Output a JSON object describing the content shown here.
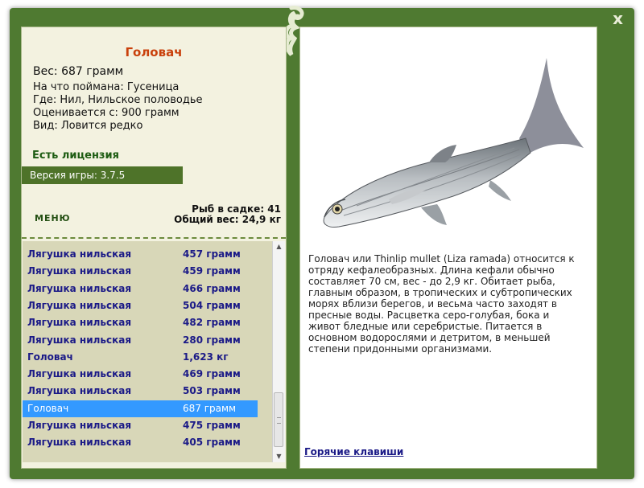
{
  "window": {
    "close_label": "x"
  },
  "fish": {
    "name": "Головач",
    "weight": "Вес: 687 грамм",
    "bait": "На что поймана: Гусеница",
    "location": "Где: Нил, Нильское половодье",
    "valued": "Оценивается с: 900 грамм",
    "kind": "Вид: Ловится редко"
  },
  "license": "Есть лицензия",
  "version": "Версия игры: 3.7.5",
  "menu_label": "МЕНЮ",
  "stats": {
    "count": "Рыб в садке: 41",
    "total": "Общий вес: 24,9 кг"
  },
  "catch_list": [
    {
      "name": "Лягушка нильская",
      "weight": "457 грамм"
    },
    {
      "name": "Лягушка нильская",
      "weight": "459 грамм"
    },
    {
      "name": "Лягушка нильская",
      "weight": "466 грамм"
    },
    {
      "name": "Лягушка нильская",
      "weight": "504 грамм"
    },
    {
      "name": "Лягушка нильская",
      "weight": "482 грамм"
    },
    {
      "name": "Лягушка нильская",
      "weight": "280 грамм"
    },
    {
      "name": "Головач",
      "weight": "1,623 кг"
    },
    {
      "name": "Лягушка нильская",
      "weight": "469 грамм"
    },
    {
      "name": "Лягушка нильская",
      "weight": "503 грамм"
    },
    {
      "name": "Головач",
      "weight": "687 грамм",
      "selected": true
    },
    {
      "name": "Лягушка нильская",
      "weight": "475 грамм"
    },
    {
      "name": "Лягушка нильская",
      "weight": "405 грамм"
    }
  ],
  "description": "Головач или Thinlip mullet (Liza ramada) относится к отряду кефалеобразных. Длина кефали обычно составляет 70 см, вес - до 2,9 кг. Обитает рыба, главным образом, в тропических и субтропических морях вблизи берегов, и весьма часто заходят в пресные воды. Расцветка серо-голубая, бока и живот бледные или серебристые. Питается в основном водорослями и детритом, в меньшей степени придонными организмами.",
  "hotkeys_label": "Горячие клавиши",
  "colors": {
    "frame": "#4f7a31",
    "panel": "#f3f2e0",
    "list_bg": "#d8d7b8",
    "title": "#c9410c",
    "list_text": "#1b1a87",
    "selected": "#3399ff"
  }
}
